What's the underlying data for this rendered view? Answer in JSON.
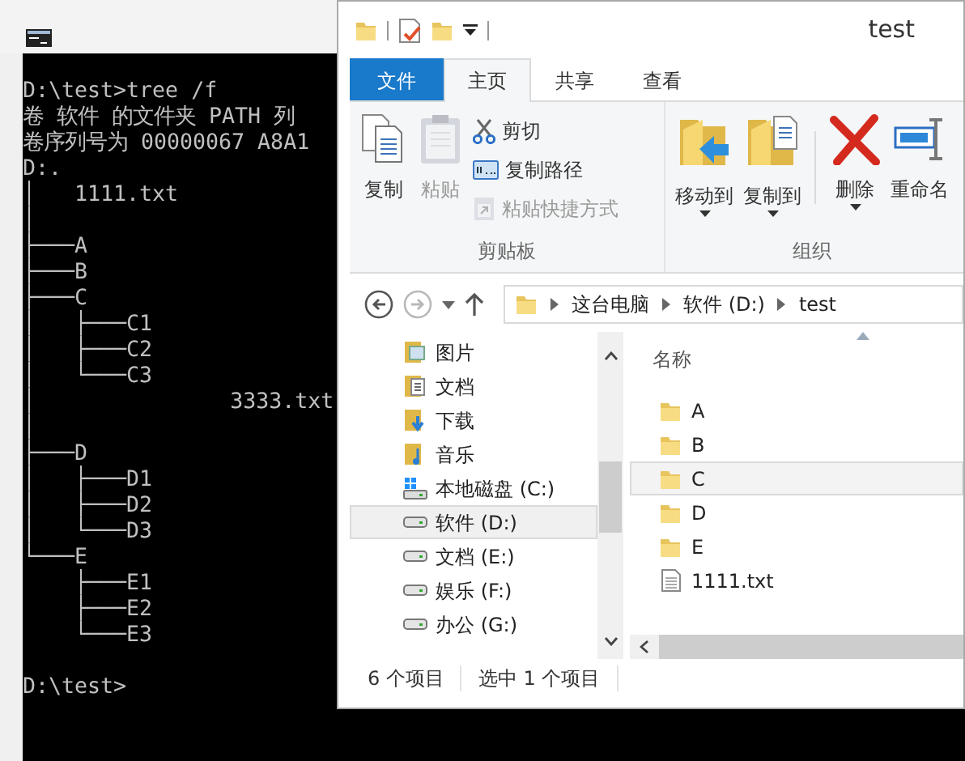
{
  "console": {
    "output_lines": [
      "D:\\test>tree /f",
      "卷 软件 的文件夹 PATH 列",
      "卷序列号为 00000067 A8A1",
      "D:.",
      "│   1111.txt",
      "│",
      "├───A",
      "├───B",
      "├───C",
      "│   ├───C1",
      "│   ├───C2",
      "│   └───C3",
      "│               3333.txt",
      "│",
      "├───D",
      "│   ├───D1",
      "│   ├───D2",
      "│   └───D3",
      "└───E",
      "    ├───E1",
      "    ├───E2",
      "    └───E3"
    ],
    "prompt": "D:\\test>"
  },
  "explorer": {
    "window": {
      "title": "test"
    },
    "tabs": [
      {
        "label": "文件",
        "kind": "file"
      },
      {
        "label": "主页",
        "kind": "tab",
        "selected": true
      },
      {
        "label": "共享",
        "kind": "tab",
        "selected": false
      },
      {
        "label": "查看",
        "kind": "tab",
        "selected": false
      }
    ],
    "ribbon_groups": [
      {
        "label": "剪贴板",
        "large_buttons": [
          {
            "label": "复制",
            "kind": "copy",
            "disabled": false
          },
          {
            "label": "粘贴",
            "kind": "paste",
            "disabled": true
          }
        ],
        "small_buttons": [
          {
            "label": "剪切",
            "kind": "cut",
            "disabled": false
          },
          {
            "label": "复制路径",
            "kind": "copy-path",
            "disabled": false
          },
          {
            "label": "粘贴快捷方式",
            "kind": "paste-shortcut",
            "disabled": true
          }
        ]
      },
      {
        "label": "组织",
        "large_buttons": [
          {
            "label": "移动到",
            "kind": "move-to",
            "dropdown": true
          },
          {
            "label": "复制到",
            "kind": "copy-to",
            "dropdown": true
          },
          {
            "label": "删除",
            "kind": "delete",
            "dropdown": true,
            "separator_before": true
          },
          {
            "label": "重命名",
            "kind": "rename",
            "dropdown": false
          }
        ]
      }
    ],
    "navigation": {
      "back_disabled": false,
      "forward_disabled": true
    },
    "breadcrumb": [
      "这台电脑",
      "软件 (D:)",
      "test"
    ],
    "nav_pane": [
      {
        "label": "图片",
        "kind": "pictures",
        "selected": false
      },
      {
        "label": "文档",
        "kind": "documents",
        "selected": false
      },
      {
        "label": "下载",
        "kind": "downloads",
        "selected": false
      },
      {
        "label": "音乐",
        "kind": "music",
        "selected": false
      },
      {
        "label": "本地磁盘 (C:)",
        "kind": "system-drive",
        "selected": false
      },
      {
        "label": "软件 (D:)",
        "kind": "drive",
        "selected": true
      },
      {
        "label": "文档 (E:)",
        "kind": "drive",
        "selected": false
      },
      {
        "label": "娱乐 (F:)",
        "kind": "drive",
        "selected": false
      },
      {
        "label": "办公 (G:)",
        "kind": "drive",
        "selected": false
      }
    ],
    "column_header": "名称",
    "files": [
      {
        "name": "A",
        "kind": "folder",
        "selected": false
      },
      {
        "name": "B",
        "kind": "folder",
        "selected": false
      },
      {
        "name": "C",
        "kind": "folder",
        "selected": true
      },
      {
        "name": "D",
        "kind": "folder",
        "selected": false
      },
      {
        "name": "E",
        "kind": "folder",
        "selected": false
      },
      {
        "name": "1111.txt",
        "kind": "file",
        "selected": false
      }
    ],
    "status_bar": [
      "6 个项目",
      "选中 1 个项目"
    ]
  }
}
